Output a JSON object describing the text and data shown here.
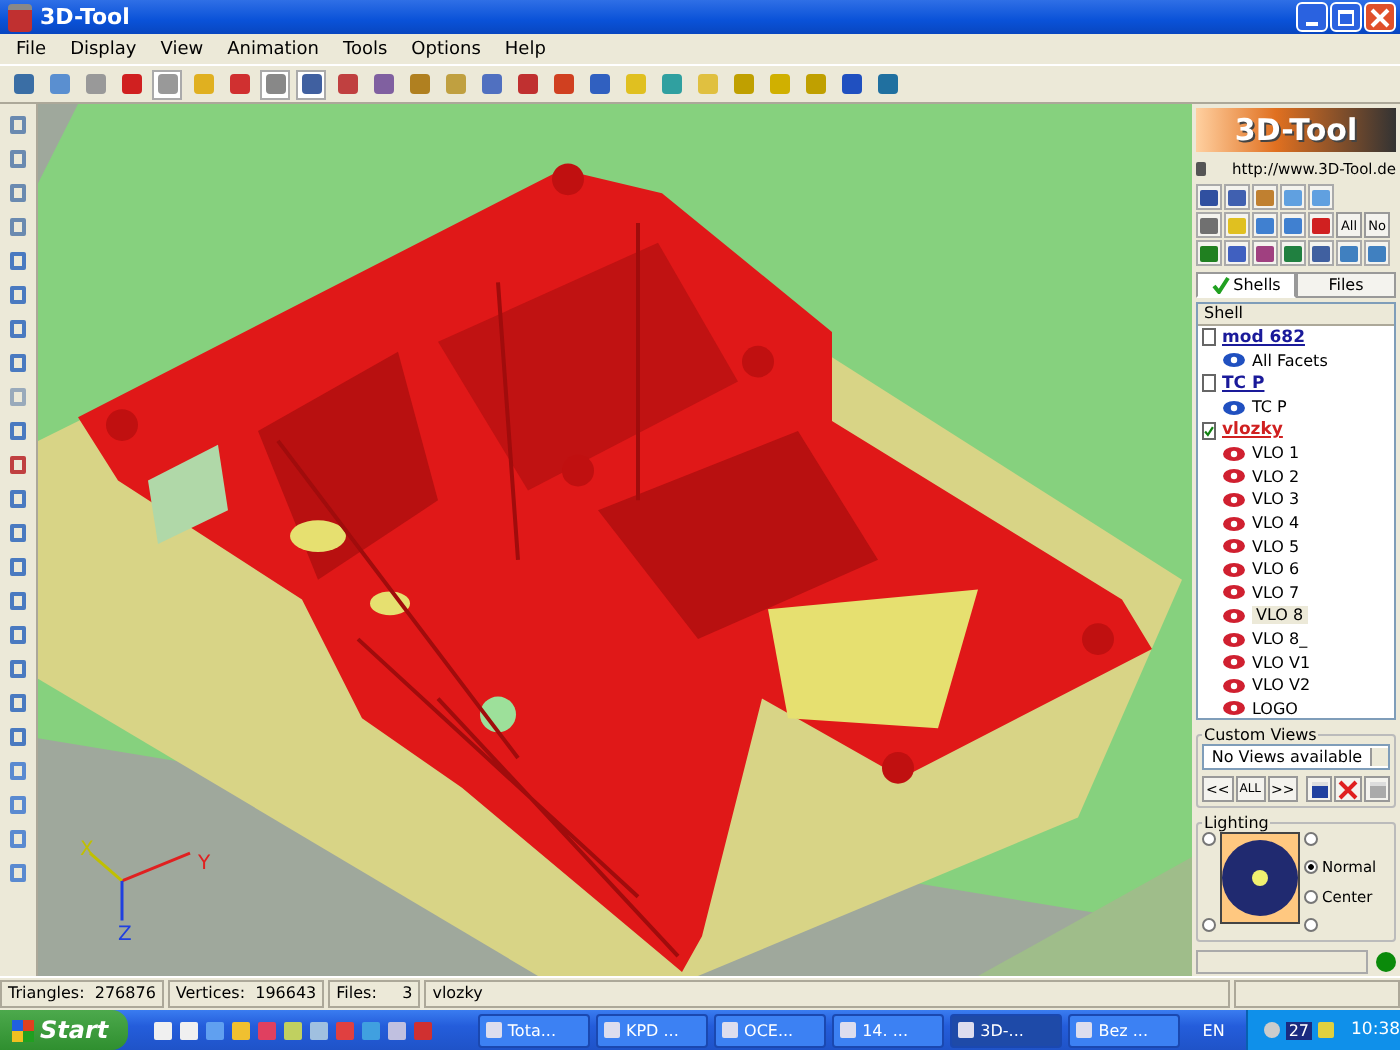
{
  "window": {
    "title": "3D-Tool"
  },
  "menu": [
    "File",
    "Display",
    "View",
    "Animation",
    "Tools",
    "Options",
    "Help"
  ],
  "viewport": {
    "axes": [
      "X",
      "Y",
      "Z"
    ]
  },
  "panel": {
    "logo": "3D-Tool",
    "url": "http://www.3D-Tool.de",
    "select_buttons": [
      "All",
      "No"
    ],
    "tabs": [
      {
        "label": "Shells",
        "selected": true
      },
      {
        "label": "Files",
        "selected": false
      }
    ],
    "tree_header": "Shell",
    "tree": [
      {
        "label": "mod 682",
        "checked": false,
        "children": [
          {
            "label": "All Facets",
            "selected": false
          }
        ]
      },
      {
        "label": "TC P",
        "checked": false,
        "children": [
          {
            "label": "TC P",
            "selected": false
          }
        ]
      },
      {
        "label": "vlozky",
        "checked": true,
        "children": [
          {
            "label": "VLO 1",
            "selected": false
          },
          {
            "label": "VLO 2",
            "selected": false
          },
          {
            "label": "VLO 3",
            "selected": false
          },
          {
            "label": "VLO 4",
            "selected": false
          },
          {
            "label": "VLO 5",
            "selected": false
          },
          {
            "label": "VLO 6",
            "selected": false
          },
          {
            "label": "VLO 7",
            "selected": false
          },
          {
            "label": "VLO 8",
            "selected": true
          },
          {
            "label": "VLO 8_",
            "selected": false
          },
          {
            "label": "VLO V1",
            "selected": false
          },
          {
            "label": "VLO V2",
            "selected": false
          },
          {
            "label": "LOGO",
            "selected": false
          }
        ]
      }
    ],
    "custom_views": {
      "title": "Custom Views",
      "dropdown": "No Views available",
      "prev": "<<",
      "all": "ALL",
      "next": ">>"
    },
    "lighting": {
      "title": "Lighting",
      "left_radios": [
        {
          "selected": false
        },
        {
          "selected": false
        }
      ],
      "right_radios": [
        {
          "selected": false
        },
        {
          "label": "Normal",
          "selected": true
        },
        {
          "label": "Center",
          "selected": false
        },
        {
          "selected": false
        }
      ]
    }
  },
  "status_bar": [
    "Triangles:  276876",
    "Vertices:  196643",
    "Files:     3",
    "vlozky"
  ],
  "taskbar": {
    "start": "Start",
    "tasks": [
      {
        "label": "Tota...",
        "selected": false
      },
      {
        "label": "KPD ...",
        "selected": false
      },
      {
        "label": "OCE...",
        "selected": false
      },
      {
        "label": "14. ...",
        "selected": false
      },
      {
        "label": "3D-...",
        "selected": true
      },
      {
        "label": "Bez ...",
        "selected": false
      }
    ],
    "language": "EN",
    "tray_badge": "27",
    "clock": "10:38"
  }
}
